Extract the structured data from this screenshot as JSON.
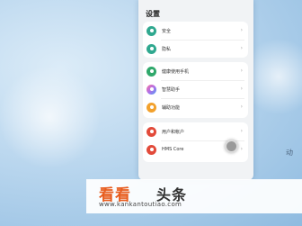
{
  "settings": {
    "title": "设置",
    "groups": [
      [
        {
          "label": "安全",
          "icon": "shield-icon",
          "color": "#2fa88f"
        },
        {
          "label": "隐私",
          "icon": "privacy-icon",
          "color": "#2fa88f"
        }
      ],
      [
        {
          "label": "健康使用手机",
          "icon": "hourglass-icon",
          "color": "#2fa86b"
        },
        {
          "label": "智慧助手",
          "icon": "assistant-icon",
          "color": "#b070e8"
        },
        {
          "label": "辅助功能",
          "icon": "accessibility-icon",
          "color": "#f2a12c"
        }
      ],
      [
        {
          "label": "用户和帐户",
          "icon": "user-icon",
          "color": "#e24a3a"
        },
        {
          "label": "HMS Core",
          "icon": "hms-icon",
          "color": "#e24a3a"
        }
      ]
    ],
    "chevron": "›"
  },
  "side_text": "动",
  "watermark": {
    "title": "看看",
    "title2": "头条",
    "url": "www.kankantoutiao.com"
  }
}
